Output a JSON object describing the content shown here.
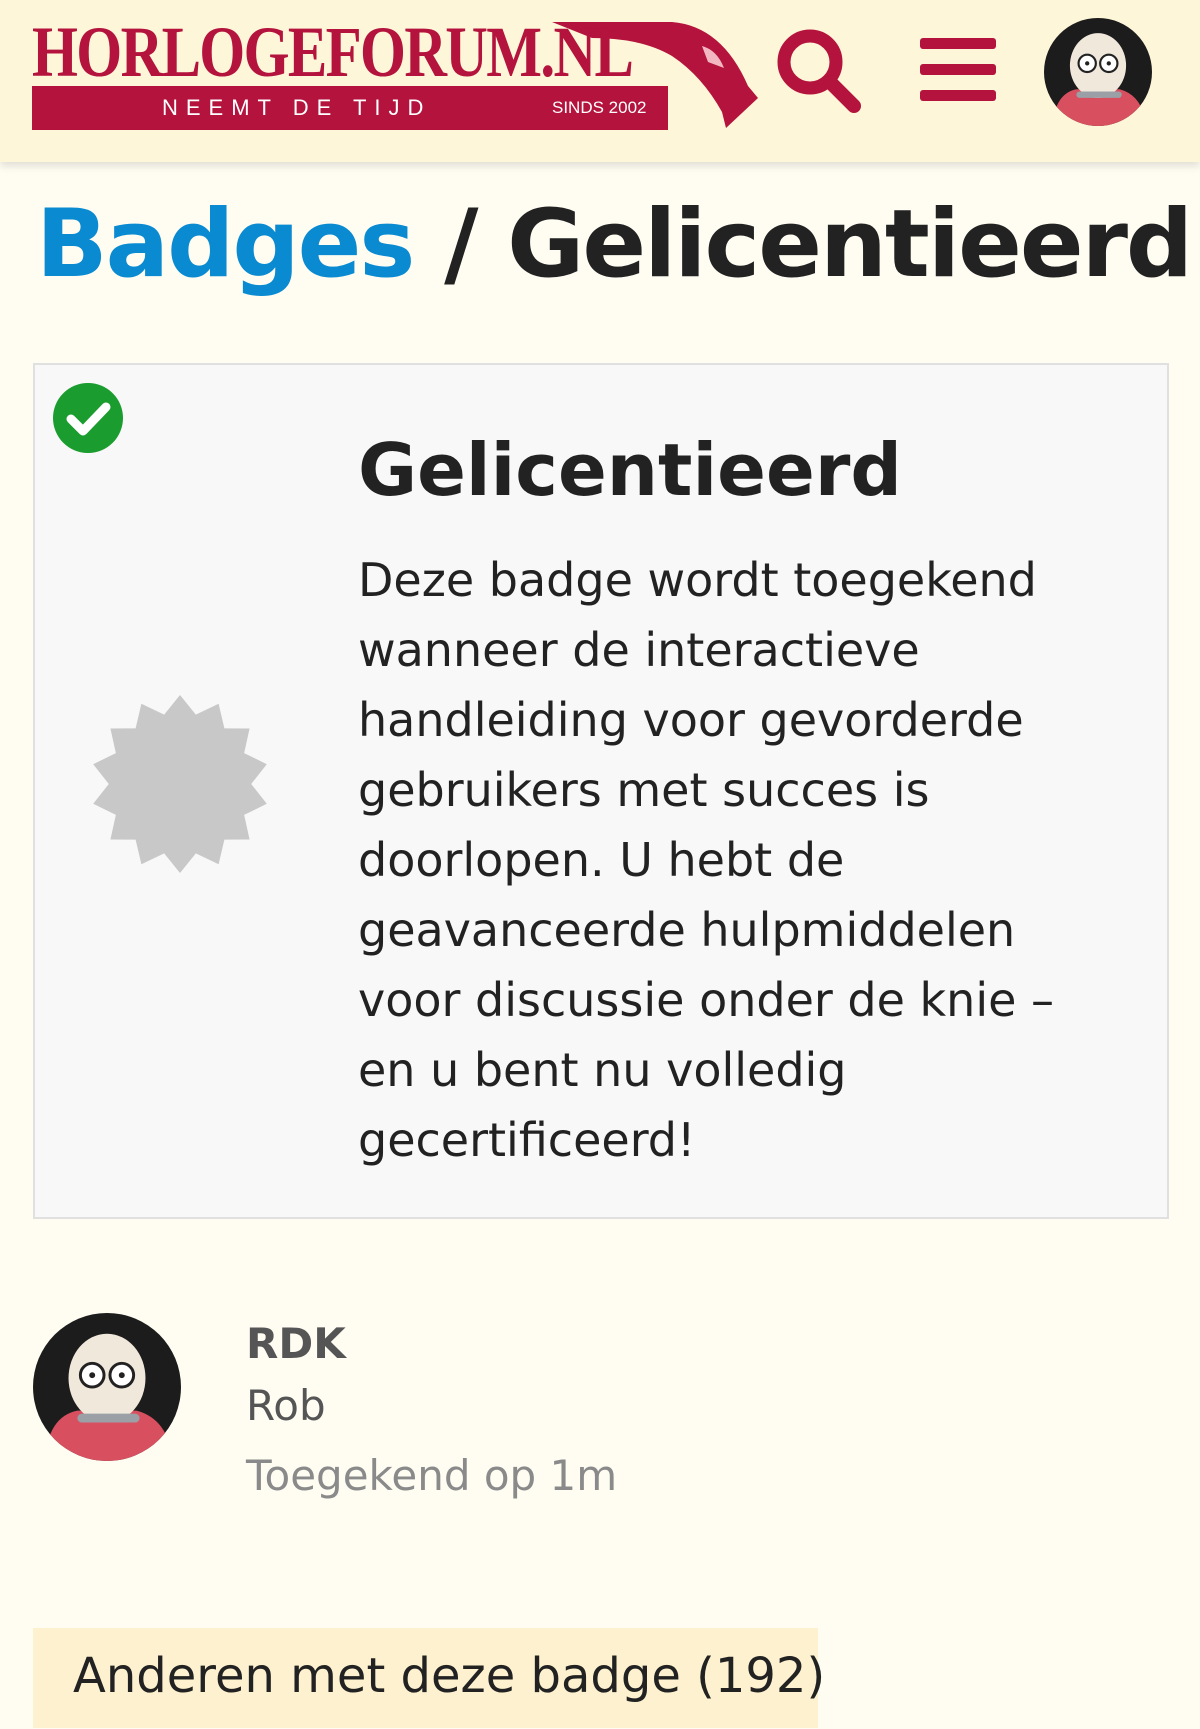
{
  "header": {
    "logo_title": "HORLOGEFORUM.NL",
    "logo_tagline": "NEEMT DE TIJD",
    "logo_since": "SINDS 2002",
    "brand_color": "#b3133c",
    "search_icon": "search-icon",
    "menu_icon": "hamburger-icon"
  },
  "breadcrumb": {
    "parent": "Badges",
    "separator": "/",
    "current": "Gelicentieerd"
  },
  "badge": {
    "name": "Gelicentieerd",
    "description": "Deze badge wordt toegekend wanneer de interactieve handleiding voor gevorderde gebruikers met succes is doorlopen. U hebt de geavanceerde hulpmiddelen voor discussie onder de knie – en u bent nu volledig gecertificeerd!",
    "granted_icon": "check-circle-icon",
    "granted_color": "#1a9c2f",
    "badge_icon": "certificate-icon"
  },
  "user": {
    "username": "RDK",
    "full_name": "Rob",
    "granted_at": "Toegekend op 1m"
  },
  "others": {
    "heading": "Anderen met deze badge (192)"
  }
}
